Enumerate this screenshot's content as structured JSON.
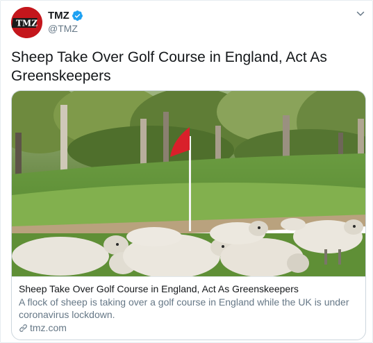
{
  "account": {
    "display_name": "TMZ",
    "handle": "@TMZ",
    "avatar_text": "TMZ",
    "verified": true
  },
  "tweet": {
    "text": "Sheep Take Over Golf Course in England, Act As Greenskeepers"
  },
  "card": {
    "title": "Sheep Take Over Golf Course in England, Act As Greenskeepers",
    "description": "A flock of sheep is taking over a golf course in England while the UK is under coronavirus lockdown.",
    "domain": "tmz.com"
  },
  "icons": {
    "verified": "verified-badge-icon",
    "menu": "chevron-down-icon",
    "link": "link-icon"
  },
  "colors": {
    "brand_red": "#c4161c",
    "verified_blue": "#1da1f2",
    "secondary_text": "#657786",
    "flag_red": "#d9202a"
  }
}
